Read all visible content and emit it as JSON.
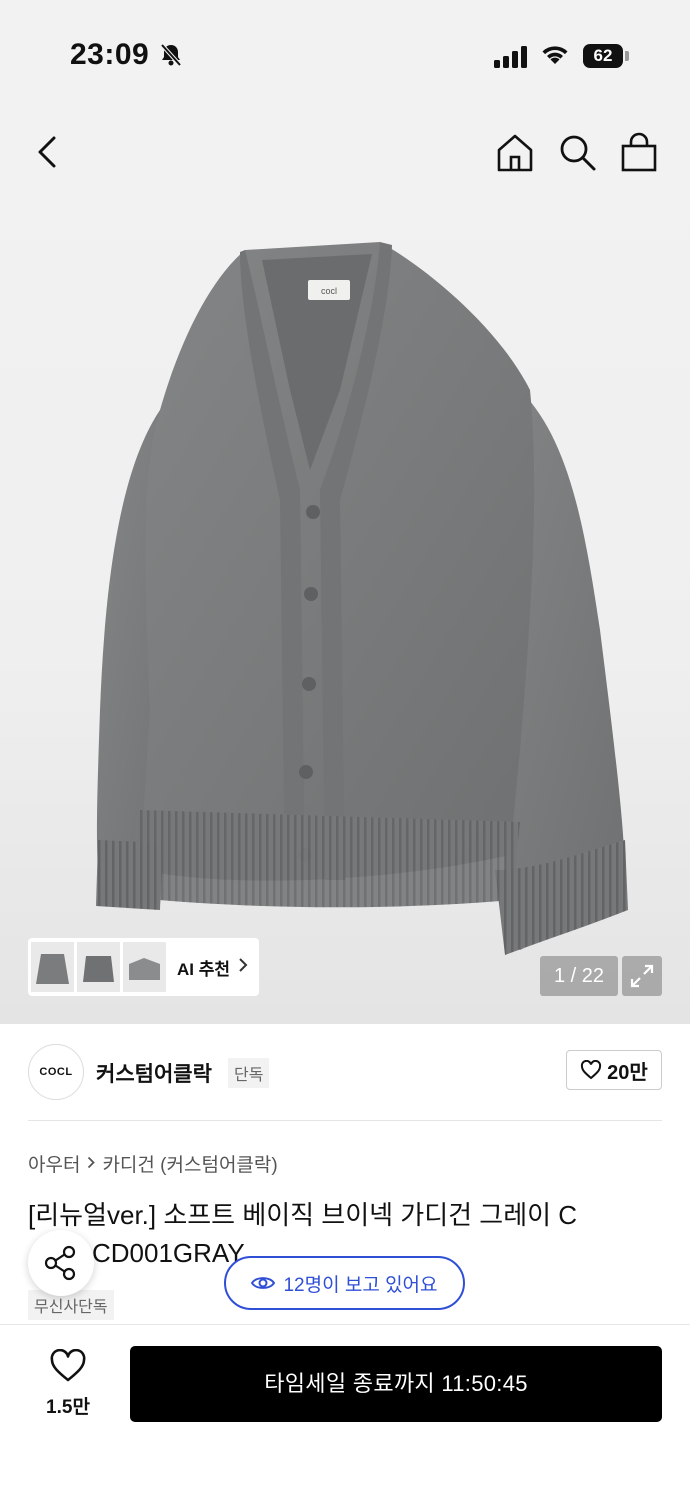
{
  "status": {
    "time": "23:09",
    "battery": "62"
  },
  "colors": {
    "accent": "#2f4fd6",
    "buy_button": "#000000",
    "cardigan": "#7a7c7d"
  },
  "icons": [
    "back-icon",
    "home-icon",
    "search-icon",
    "bag-icon",
    "heart-icon",
    "share-icon",
    "eye-icon",
    "expand-icon"
  ],
  "gallery": {
    "ai_label": "AI 추천",
    "counter": "1 / 22",
    "garment_label": "cocl"
  },
  "brand": {
    "logo_text": "COCL",
    "name": "커스텀어클락",
    "tag": "단독",
    "likes": "20만"
  },
  "breadcrumb": {
    "category": "아우터",
    "subcategory": "카디건 (커스텀어클락)"
  },
  "product": {
    "title_line1": "[리뉴얼ver.] 소프트 베이직 브이넥 가디건 그레이 C",
    "title_line2": "CD001GRAY",
    "exclusive_tag": "무신사단독"
  },
  "viewers": {
    "text": "12명이 보고 있어요"
  },
  "bottom": {
    "wish_count": "1.5만",
    "buy_label": "타임세일 종료까지 11:50:45"
  }
}
